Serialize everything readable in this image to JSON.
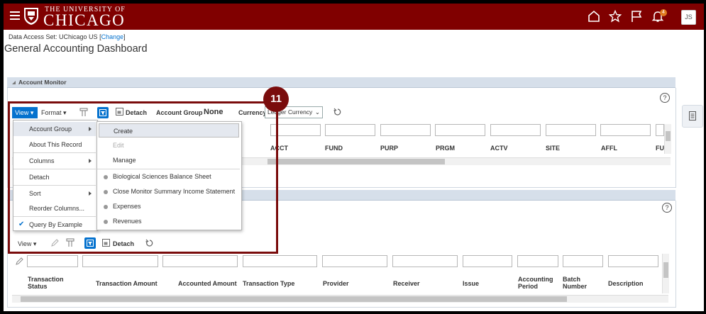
{
  "header": {
    "logo_top": "THE UNIVERSITY OF",
    "logo_main": "CHICAGO",
    "notification_count": "4",
    "user_initials": "JS",
    "brand_color": "#800000"
  },
  "data_access": {
    "label": "Data Access Set: UChicago US",
    "change_open": "[",
    "change_link": "Change",
    "change_close": "]"
  },
  "page_title": "General Accounting Dashboard",
  "account_monitor": {
    "title": "Account Monitor",
    "toolbar": {
      "view": "View",
      "format": "Format",
      "detach": "Detach",
      "account_group_label": "Account Group",
      "account_group_value": "None",
      "currency_label": "Currency",
      "currency_value": "Ledger Currency"
    },
    "columns": [
      "ACCT",
      "FUND",
      "PURP",
      "PRGM",
      "ACTV",
      "SITE",
      "AFFL",
      "FU"
    ]
  },
  "view_menu": {
    "items": [
      "Account Group",
      "About This Record",
      "Columns",
      "Detach",
      "Sort",
      "Reorder Columns...",
      "Query By Example"
    ],
    "checkmark": "✔"
  },
  "account_group_menu": {
    "items": [
      "Create",
      "Edit",
      "Manage"
    ],
    "groups": [
      "Biological Sciences Balance Sheet",
      "Close Monitor Summary Income Statement",
      "Expenses",
      "Revenues"
    ]
  },
  "journals": {
    "toolbar": {
      "view": "View",
      "detach": "Detach"
    },
    "columns": [
      "Transaction Status",
      "Transaction Amount",
      "Accounted Amount",
      "Transaction Type",
      "Provider",
      "Receiver",
      "Issue",
      "Accounting Period",
      "Batch Number",
      "Description"
    ]
  },
  "step_number": "11"
}
